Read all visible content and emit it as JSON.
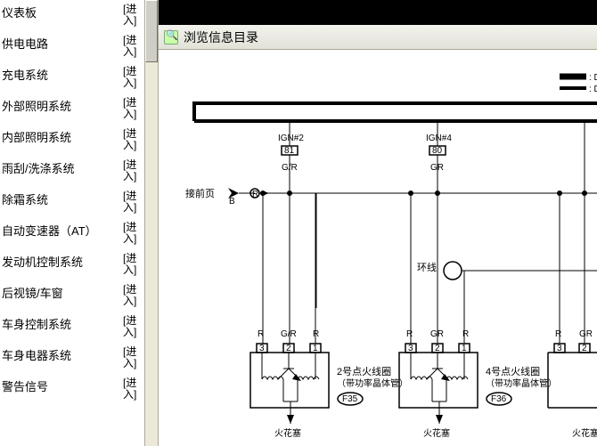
{
  "sidebar": {
    "items": [
      {
        "label": "仪表板",
        "link": "[进入]"
      },
      {
        "label": "供电电路",
        "link": "[进入]"
      },
      {
        "label": "充电系统",
        "link": "[进入]"
      },
      {
        "label": "外部照明系统",
        "link": "[进入]"
      },
      {
        "label": "内部照明系统",
        "link": "[进入]"
      },
      {
        "label": "雨刮/洗涤系统",
        "link": "[进入]"
      },
      {
        "label": "除霜系统",
        "link": "[进入]"
      },
      {
        "label": "自动变速器（AT）",
        "link": "[进入]"
      },
      {
        "label": "发动机控制系统",
        "link": "[进入]"
      },
      {
        "label": "后视镜/车窗",
        "link": "[进入]"
      },
      {
        "label": "车身控制系统",
        "link": "[进入]"
      },
      {
        "label": "车身电器系统",
        "link": "[进入]"
      },
      {
        "label": "警告信号",
        "link": "[进入]"
      }
    ]
  },
  "header": {
    "title": "浏览信息目录"
  },
  "diagram": {
    "prev_page": "接前页",
    "ign2": "IGN#2",
    "ign4": "IGN#4",
    "pin81": "81",
    "pin80": "80",
    "gr": "G/R",
    "gr2": "GR",
    "r": "R",
    "b": "B",
    "ring": "环线",
    "coil2_title": "2号点火线圈",
    "coil2_sub": "（带功率晶体管）",
    "coil4_title": "4号点火线圈",
    "coil4_sub": "（带功率晶体管）",
    "f35": "F35",
    "f36": "F36",
    "spark": "火花塞",
    "pin1": "1",
    "pin2": "2",
    "pin3": "3",
    "legend_d": ": D"
  }
}
